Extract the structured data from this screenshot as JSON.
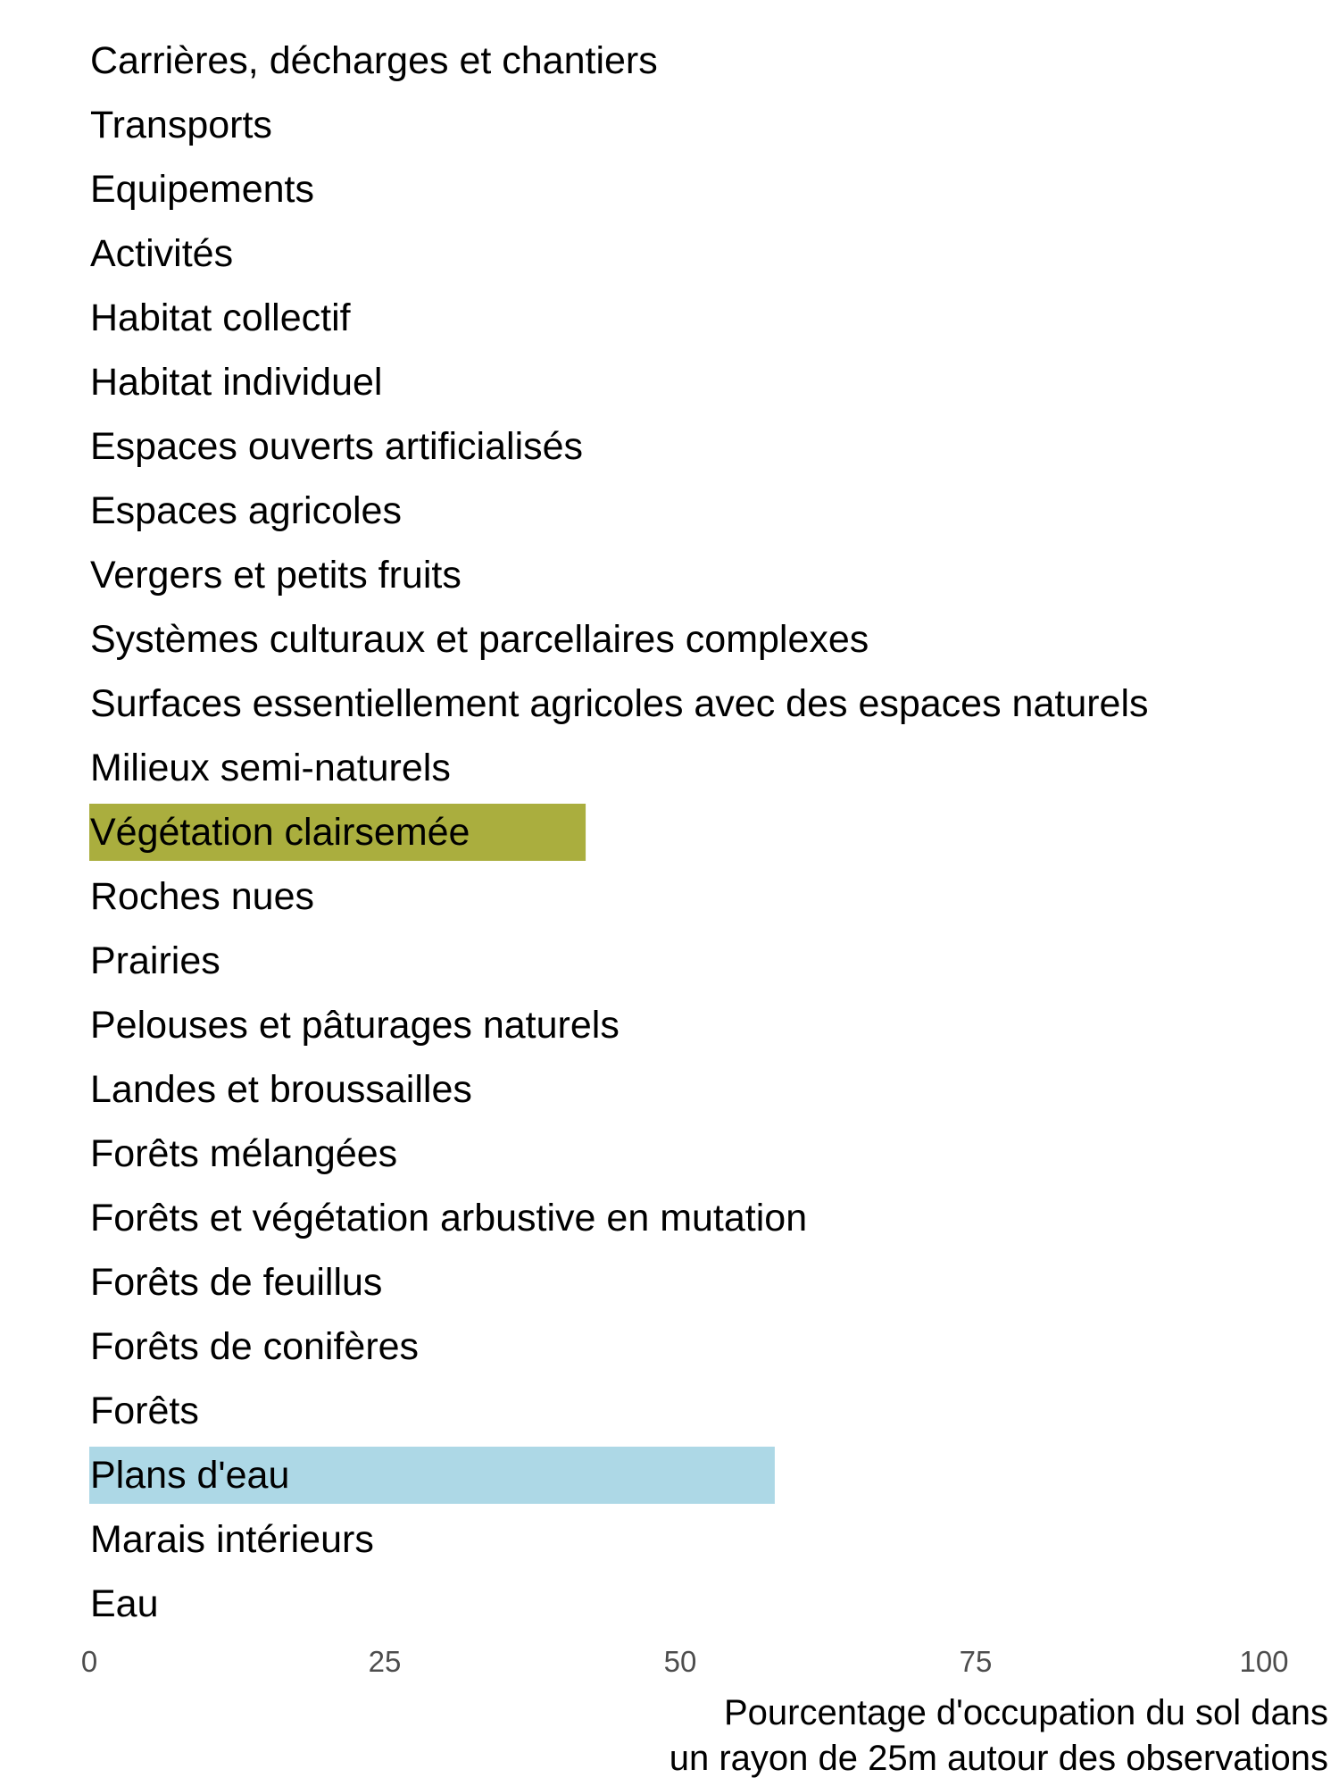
{
  "chart_data": {
    "type": "bar",
    "orientation": "horizontal",
    "categories": [
      "Carrières, décharges et chantiers",
      "Transports",
      "Equipements",
      "Activités",
      "Habitat collectif",
      "Habitat individuel",
      "Espaces ouverts artificialisés",
      "Espaces agricoles",
      "Vergers et petits fruits",
      "Systèmes culturaux et parcellaires complexes",
      "Surfaces essentiellement agricoles avec des espaces naturels",
      "Milieux semi-naturels",
      "Végétation clairsemée",
      "Roches nues",
      "Prairies",
      "Pelouses et pâturages naturels",
      "Landes et broussailles",
      "Forêts mélangées",
      "Forêts et végétation arbustive en mutation",
      "Forêts de feuillus",
      "Forêts de conifères",
      "Forêts",
      "Plans d'eau",
      "Marais intérieurs",
      "Eau"
    ],
    "values": [
      0,
      0,
      0,
      0,
      0,
      0,
      0,
      0,
      0,
      0,
      0,
      0,
      42,
      0,
      0,
      0,
      0,
      0,
      0,
      0,
      0,
      0,
      58,
      0,
      0
    ],
    "colors": [
      "#999999",
      "#999999",
      "#999999",
      "#999999",
      "#999999",
      "#999999",
      "#999999",
      "#999999",
      "#999999",
      "#999999",
      "#999999",
      "#999999",
      "#aaae3e",
      "#999999",
      "#999999",
      "#999999",
      "#999999",
      "#999999",
      "#999999",
      "#999999",
      "#999999",
      "#999999",
      "#add8e6",
      "#999999",
      "#999999"
    ],
    "xlim": [
      0,
      100
    ],
    "xticks": [
      0,
      25,
      50,
      75,
      100
    ],
    "xlabel": [
      "Pourcentage d'occupation du sol dans",
      "un rayon de 25m autour des observations"
    ],
    "grid": false,
    "legend": "none"
  }
}
